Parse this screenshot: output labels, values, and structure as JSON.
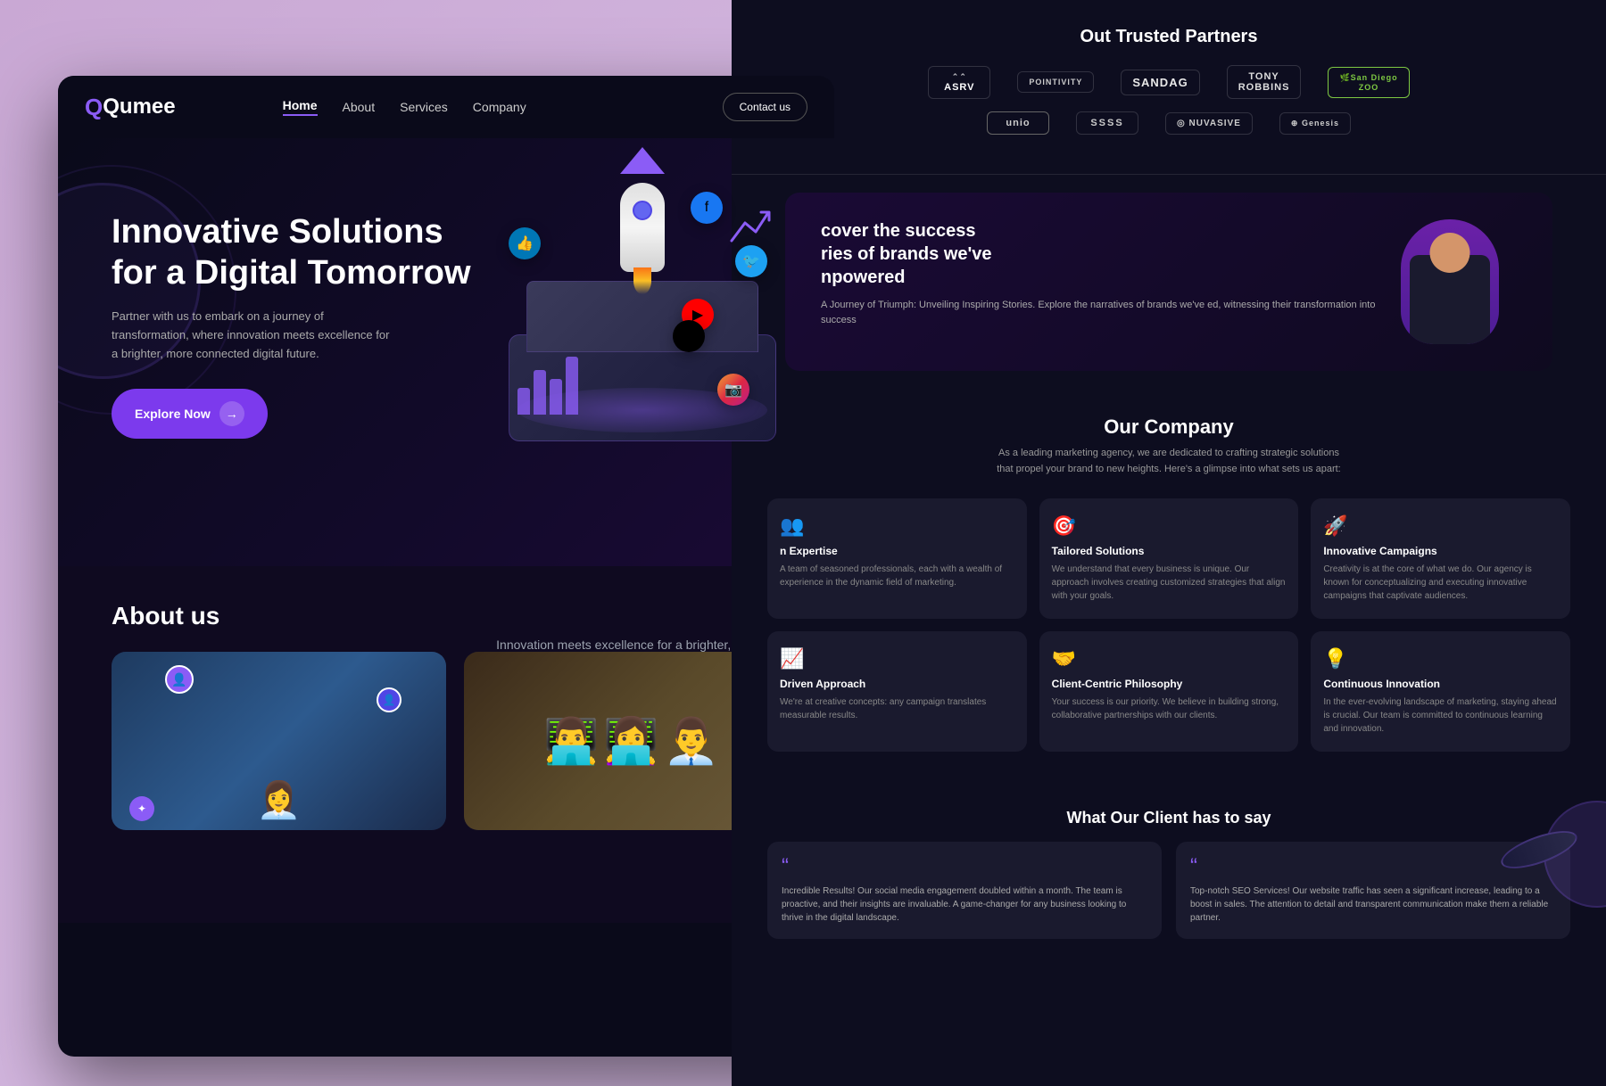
{
  "page": {
    "title": "Qumee - Innovative Solutions"
  },
  "nav": {
    "logo": "Qumee",
    "links": [
      {
        "label": "Home",
        "active": true
      },
      {
        "label": "About",
        "active": false
      },
      {
        "label": "Services",
        "active": false
      },
      {
        "label": "Company",
        "active": false
      }
    ],
    "contact_btn": "Contact us"
  },
  "hero": {
    "title_line1": "Innovative Solutions",
    "title_line2": "for a Digital Tomorrow",
    "subtitle": "Partner with us to embark on a journey of transformation, where innovation meets excellence for a brighter, more connected digital future.",
    "cta": "Explore Now"
  },
  "about": {
    "title": "About us",
    "tagline": "Innovation meets excellence for a brighter, more connected digital future."
  },
  "right_panel": {
    "partners_title": "Out Trusted Partners",
    "partners_row1": [
      "ASRV",
      "POINTIVITY",
      "SANDAG",
      "TONY ROBBINS",
      "ZOO"
    ],
    "partners_row2": [
      "unio",
      "SSSS",
      "NUVASIVE",
      "Genesis"
    ],
    "success": {
      "title": "cover the success ries of brands we've npowered",
      "subtitle": "A Journey of Triumph: Unveiling Inspiring Stories. Explore the narratives of brands we've ed, witnessing their transformation into success"
    },
    "company": {
      "title": "Our Company",
      "desc": "As a leading marketing agency, we are dedicated to crafting strategic solutions that propel your brand to new heights. Here's a glimpse into what sets us apart:",
      "features": [
        {
          "icon": "👥",
          "title": "n Expertise",
          "desc": "A team of seasoned professionals, each with a wealth of experience in the dynamic field of marketing."
        },
        {
          "icon": "🎯",
          "title": "Tailored Solutions",
          "desc": "We understand that every business is unique. Our approach involves creating customized strategies that align with your goals."
        },
        {
          "icon": "🚀",
          "title": "Innovative Campaigns",
          "desc": "Creativity is at the core of what we do. Our agency is known for conceptualizing and executing innovative campaigns that captivate audiences."
        },
        {
          "icon": "📈",
          "title": "Driven Approach",
          "desc": "We're at creative concepts: any campaign translates measurable results."
        },
        {
          "icon": "🤝",
          "title": "Client-Centric Philosophy",
          "desc": "Your success is our priority. We believe in building strong, collaborative partnerships with our clients."
        },
        {
          "icon": "💡",
          "title": "Continuous Innovation",
          "desc": "In the ever-evolving landscape of marketing, staying ahead is crucial. Our team is committed to continuous learning and innovation."
        }
      ]
    },
    "testimonials": {
      "title": "What Our Client has to say",
      "items": [
        {
          "quote": "“",
          "text": "Incredible Results! Our social media engagement doubled within a month. The team is proactive, and their insights are invaluable. A game-changer for any business looking to thrive in the digital landscape."
        },
        {
          "quote": "“",
          "text": "Top-notch SEO Services! Our website traffic has seen a significant increase, leading to a boost in sales. The attention to detail and transparent communication make them a reliable partner."
        }
      ]
    }
  }
}
